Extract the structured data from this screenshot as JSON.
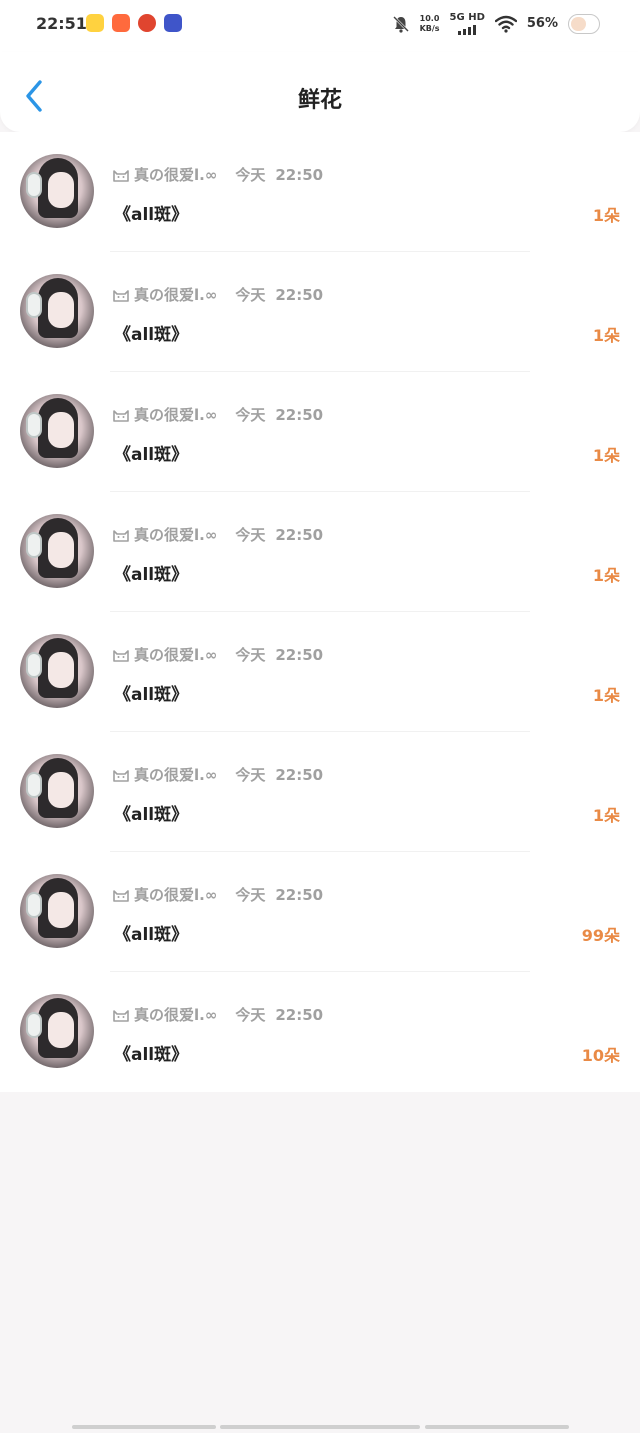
{
  "status_bar": {
    "time": "22:51",
    "net_speed_top": "10.0",
    "net_speed_bottom": "KB/s",
    "network": "5G HD",
    "battery": "56%"
  },
  "header": {
    "title": "鲜花"
  },
  "flowers": [
    {
      "username": "真の很爱l.∞",
      "day": "今天",
      "time": "22:50",
      "message": "《all斑》",
      "count": "1朵"
    },
    {
      "username": "真の很爱l.∞",
      "day": "今天",
      "time": "22:50",
      "message": "《all斑》",
      "count": "1朵"
    },
    {
      "username": "真の很爱l.∞",
      "day": "今天",
      "time": "22:50",
      "message": "《all斑》",
      "count": "1朵"
    },
    {
      "username": "真の很爱l.∞",
      "day": "今天",
      "time": "22:50",
      "message": "《all斑》",
      "count": "1朵"
    },
    {
      "username": "真の很爱l.∞",
      "day": "今天",
      "time": "22:50",
      "message": "《all斑》",
      "count": "1朵"
    },
    {
      "username": "真の很爱l.∞",
      "day": "今天",
      "time": "22:50",
      "message": "《all斑》",
      "count": "1朵"
    },
    {
      "username": "真の很爱l.∞",
      "day": "今天",
      "time": "22:50",
      "message": "《all斑》",
      "count": "99朵"
    },
    {
      "username": "真の很爱l.∞",
      "day": "今天",
      "time": "22:50",
      "message": "《all斑》",
      "count": "10朵"
    }
  ],
  "colors": {
    "accent_blue": "#2b95e6",
    "count_orange": "#e98a46"
  }
}
